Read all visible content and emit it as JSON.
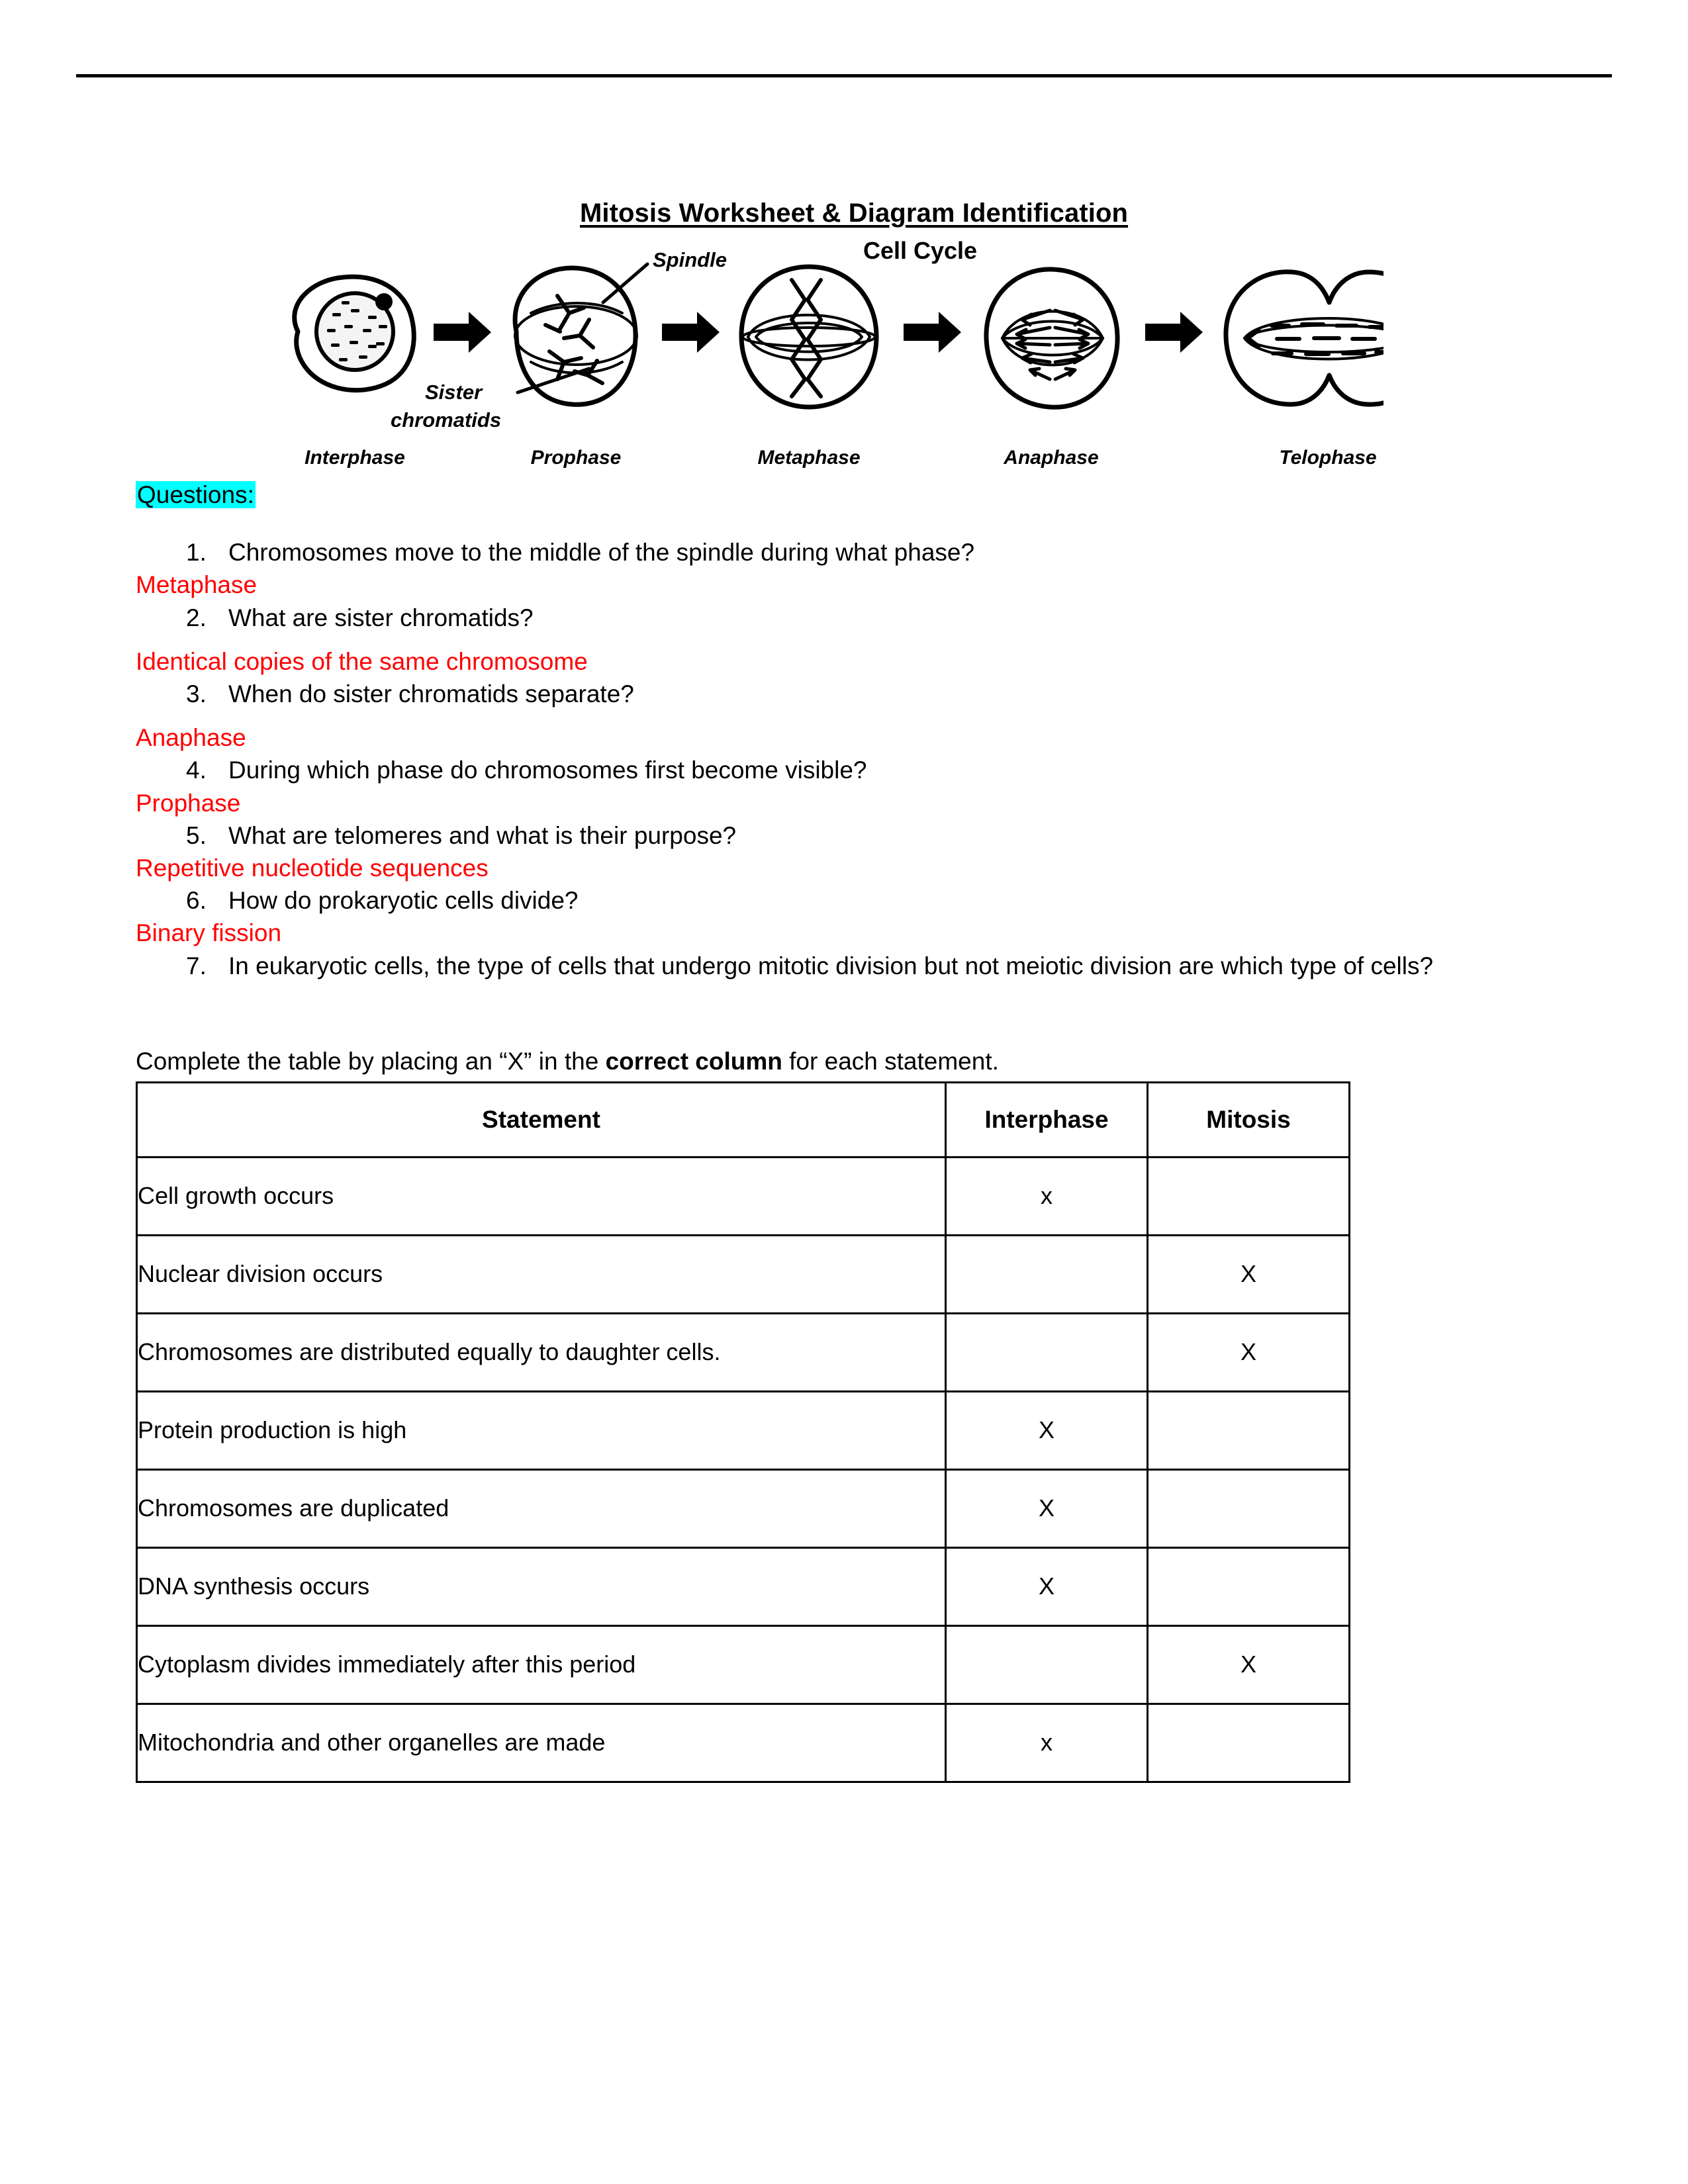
{
  "document": {
    "title": "Mitosis Worksheet & Diagram Identification"
  },
  "diagram": {
    "title": "Cell Cycle",
    "callouts": {
      "spindle": "Spindle",
      "sister_chromatids_line1": "Sister",
      "sister_chromatids_line2": "chromatids"
    },
    "phases": [
      {
        "label": "Interphase"
      },
      {
        "label": "Prophase"
      },
      {
        "label": "Metaphase"
      },
      {
        "label": "Anaphase"
      },
      {
        "label": "Telophase"
      }
    ]
  },
  "questions_section": {
    "heading": "Questions:",
    "highlight_color": "#00FFFF",
    "answer_color": "#FF0000",
    "items": [
      {
        "number": "1.",
        "question": "Chromosomes move to the middle of the spindle during what phase?",
        "answer": "Metaphase"
      },
      {
        "number": "2.",
        "question": "What are sister chromatids?",
        "answer": "Identical copies of the same chromosome"
      },
      {
        "number": "3.",
        "question": "When do sister chromatids separate?",
        "answer": "Anaphase"
      },
      {
        "number": "4.",
        "question": "During which phase do chromosomes first become visible?",
        "answer": "Prophase"
      },
      {
        "number": "5.",
        "question": "What are telomeres and what is their purpose?",
        "answer": "Repetitive nucleotide sequences"
      },
      {
        "number": "6.",
        "question": "How do prokaryotic cells divide?",
        "answer": "Binary fission"
      },
      {
        "number": "7.",
        "question": "In eukaryotic cells, the type of cells that undergo mitotic division but not meiotic division are which type of cells?",
        "answer": ""
      }
    ]
  },
  "table_section": {
    "intro_before": "Complete the table by placing an “X” in the ",
    "intro_bold": "correct column",
    "intro_after": " for each statement.",
    "headers": {
      "statement": "Statement",
      "interphase": "Interphase",
      "mitosis": "Mitosis"
    },
    "rows": [
      {
        "statement": "Cell growth occurs",
        "interphase": "x",
        "mitosis": ""
      },
      {
        "statement": "Nuclear division occurs",
        "interphase": "",
        "mitosis": "X"
      },
      {
        "statement": "Chromosomes are distributed equally to daughter cells.",
        "interphase": "",
        "mitosis": "X"
      },
      {
        "statement": "Protein production is high",
        "interphase": "X",
        "mitosis": ""
      },
      {
        "statement": "Chromosomes are duplicated",
        "interphase": "X",
        "mitosis": ""
      },
      {
        "statement": "DNA synthesis occurs",
        "interphase": "X",
        "mitosis": ""
      },
      {
        "statement": "Cytoplasm divides immediately after this period",
        "interphase": "",
        "mitosis": "X"
      },
      {
        "statement": "Mitochondria and other organelles are made",
        "interphase": "x",
        "mitosis": ""
      }
    ]
  }
}
